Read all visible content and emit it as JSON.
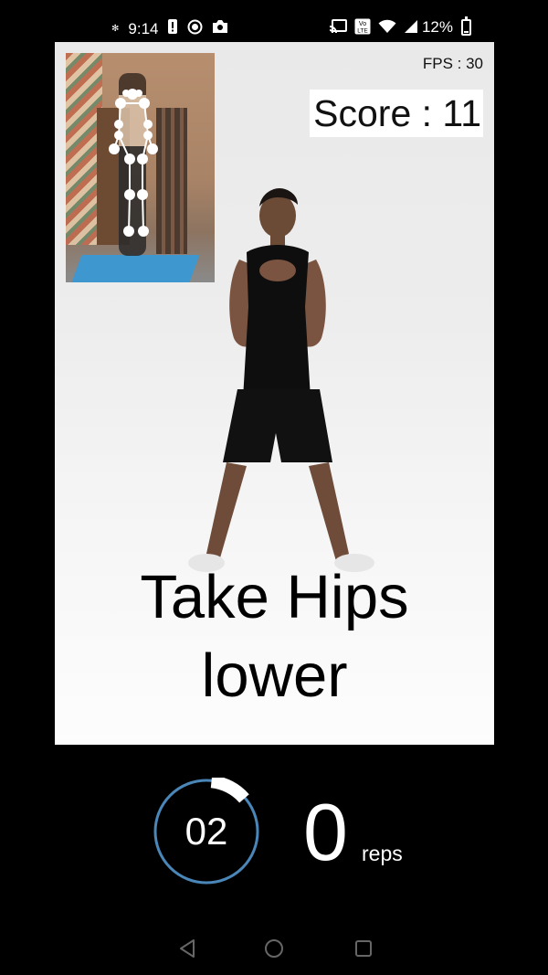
{
  "status_bar": {
    "time": "9:14",
    "left_icons": [
      "gear-icon",
      "alert-icon",
      "record-icon",
      "camera-icon"
    ],
    "right_icons": [
      "cast-icon",
      "volte-icon",
      "wifi-icon",
      "signal-icon"
    ],
    "volte_label": "Vo\nLTE",
    "battery": "12%"
  },
  "camera": {
    "fps_label": "FPS : 30",
    "score_label": "Score : 11",
    "instruction_line1": "Take Hips",
    "instruction_line2": "lower"
  },
  "counters": {
    "timer_value": "02",
    "reps_value": "0",
    "reps_label": "reps",
    "timer_progress": 0.03
  },
  "navigation": {
    "buttons": [
      "back-icon",
      "home-icon",
      "recents-icon"
    ]
  },
  "colors": {
    "background": "#000000",
    "timer_ring": "#4a86b8",
    "mat": "#3f97cf",
    "pose_dots": "#ffffff"
  }
}
